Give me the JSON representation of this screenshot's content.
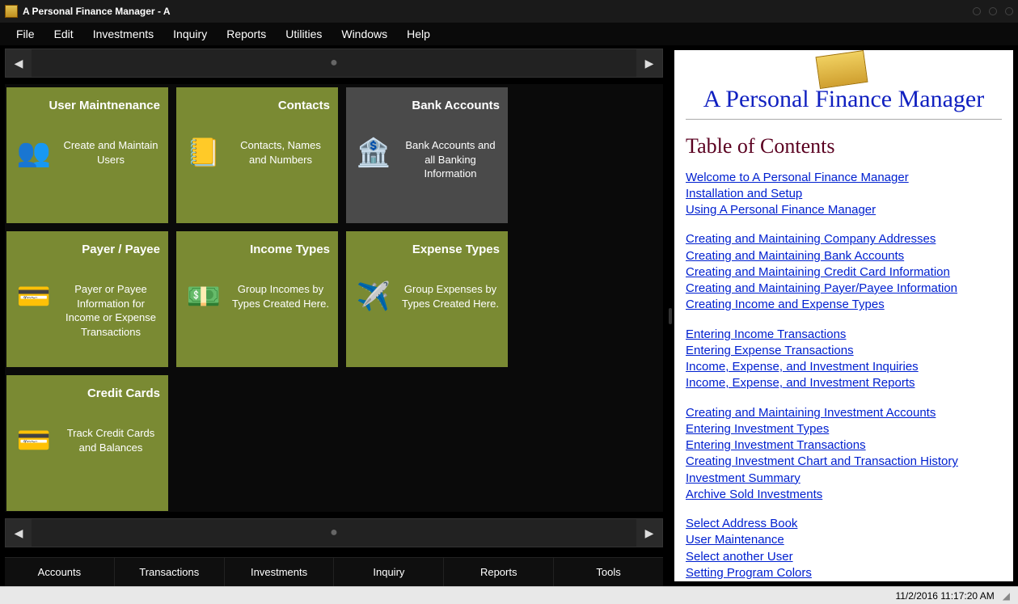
{
  "window": {
    "title": "A Personal Finance Manager - A"
  },
  "menu": {
    "items": [
      "File",
      "Edit",
      "Investments",
      "Inquiry",
      "Reports",
      "Utilities",
      "Windows",
      "Help"
    ]
  },
  "tiles": [
    {
      "title": "User Maintnenance",
      "desc": "Create and Maintain Users",
      "icon": "👥",
      "grey": false,
      "name": "tile-user-maintenance"
    },
    {
      "title": "Contacts",
      "desc": "Contacts, Names and Numbers",
      "icon": "📒",
      "grey": false,
      "name": "tile-contacts"
    },
    {
      "title": "Bank Accounts",
      "desc": "Bank Accounts and all Banking Information",
      "icon": "🏦",
      "grey": true,
      "name": "tile-bank-accounts"
    },
    {
      "title": "Payer / Payee",
      "desc": "Payer or Payee Information for Income or Expense Transactions",
      "icon": "💳",
      "grey": false,
      "name": "tile-payer-payee"
    },
    {
      "title": "Income Types",
      "desc": "Group Incomes by Types Created Here.",
      "icon": "💵",
      "grey": false,
      "name": "tile-income-types"
    },
    {
      "title": "Expense Types",
      "desc": "Group Expenses by Types Created Here.",
      "icon": "✈️",
      "grey": false,
      "name": "tile-expense-types"
    },
    {
      "title": "Credit Cards",
      "desc": "Track Credit Cards and Balances",
      "icon": "💳",
      "grey": false,
      "name": "tile-credit-cards"
    }
  ],
  "bottom_tabs": [
    "Accounts",
    "Transactions",
    "Investments",
    "Inquiry",
    "Reports",
    "Tools"
  ],
  "help": {
    "app_title": "A Personal Finance Manager",
    "toc_heading": "Table of Contents",
    "groups": [
      [
        "Welcome to A Personal Finance Manager",
        "Installation and Setup",
        "Using A Personal Finance Manager"
      ],
      [
        "Creating and Maintaining Company Addresses",
        "Creating and Maintaining Bank Accounts",
        "Creating and Maintaining Credit Card Information",
        "Creating and Maintaining Payer/Payee Information",
        "Creating Income and Expense Types"
      ],
      [
        "Entering Income Transactions",
        "Entering Expense Transactions",
        "Income, Expense, and Investment Inquiries",
        "Income, Expense, and Investment Reports"
      ],
      [
        "Creating and Maintaining Investment Accounts",
        "Entering Investment Types",
        "Entering Investment Transactions",
        "Creating Investment Chart and Transaction History",
        "Investment Summary",
        "Archive Sold Investments"
      ],
      [
        "Select Address Book",
        "User Maintenance",
        "Select another User",
        "Setting Program Colors"
      ]
    ]
  },
  "status": {
    "datetime": "11/2/2016 11:17:20 AM"
  }
}
